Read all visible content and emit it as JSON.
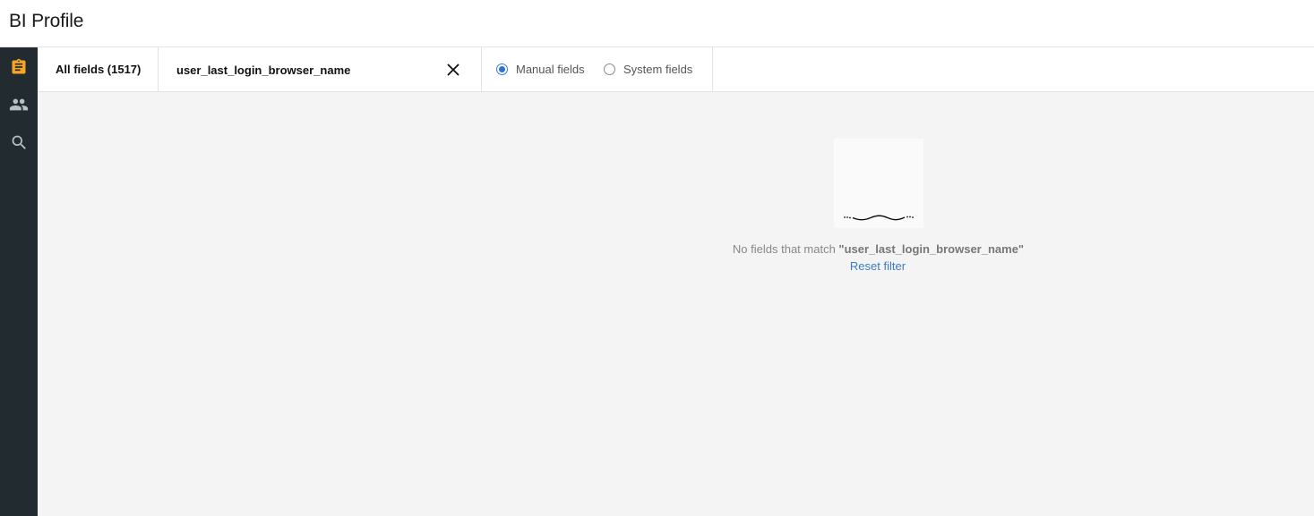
{
  "app": {
    "title": "BI Profile"
  },
  "sidebar": {
    "items": [
      {
        "icon": "clipboard-icon",
        "color": "#f5a623",
        "active": true
      },
      {
        "icon": "people-icon",
        "color": "#b8c0c4",
        "active": false
      },
      {
        "icon": "search-icon",
        "color": "#b8c0c4",
        "active": false
      }
    ]
  },
  "toolbar": {
    "all_fields_label": "All fields (1517)",
    "search": {
      "value": "user_last_login_browser_name",
      "placeholder": ""
    },
    "radios": [
      {
        "label": "Manual fields",
        "checked": true
      },
      {
        "label": "System fields",
        "checked": false
      }
    ]
  },
  "empty_state": {
    "message_prefix": "No fields that match ",
    "query": "\"user_last_login_browser_name\"",
    "reset_label": "Reset filter"
  },
  "colors": {
    "accent": "#2f6fd6",
    "sidebar_bg": "#222c30",
    "link": "#3b7cc4",
    "main_bg": "#f4f4f4"
  }
}
